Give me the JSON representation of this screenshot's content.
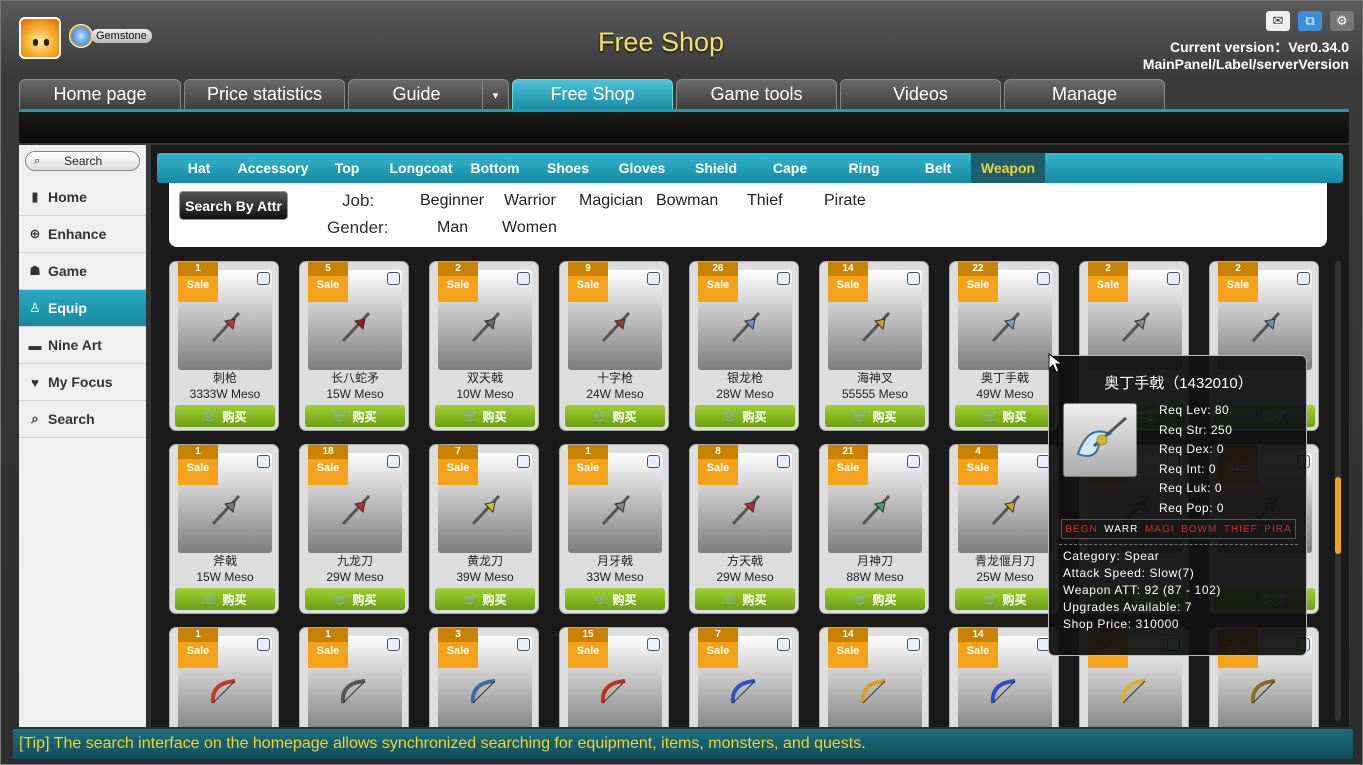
{
  "header": {
    "title": "Free Shop",
    "gem_label": "Gemstone",
    "version": "Current version：Ver0.34.0",
    "server_label": "MainPanel/Label/serverVersion"
  },
  "main_tabs": [
    {
      "label": "Home page"
    },
    {
      "label": "Price statistics"
    },
    {
      "label": "Guide"
    },
    {
      "label": "Free Shop"
    },
    {
      "label": "Game tools"
    },
    {
      "label": "Videos"
    },
    {
      "label": "Manage"
    }
  ],
  "sidebar": {
    "search_label": "Search",
    "items": [
      {
        "label": "Home",
        "icon": "bookmark-icon"
      },
      {
        "label": "Enhance",
        "icon": "plus-circle-icon"
      },
      {
        "label": "Game",
        "icon": "user-icon"
      },
      {
        "label": "Equip",
        "icon": "person-icon"
      },
      {
        "label": "Nine Art",
        "icon": "card-icon"
      },
      {
        "label": "My Focus",
        "icon": "heart-icon"
      },
      {
        "label": "Search",
        "icon": "search-icon"
      }
    ]
  },
  "category_tabs": [
    {
      "label": "Hat"
    },
    {
      "label": "Accessory"
    },
    {
      "label": "Top"
    },
    {
      "label": "Longcoat"
    },
    {
      "label": "Bottom"
    },
    {
      "label": "Shoes"
    },
    {
      "label": "Gloves"
    },
    {
      "label": "Shield"
    },
    {
      "label": "Cape"
    },
    {
      "label": "Ring"
    },
    {
      "label": "Belt"
    },
    {
      "label": "Weapon"
    }
  ],
  "filter": {
    "button": "Search By Attr",
    "job_label": "Job:",
    "gender_label": "Gender:",
    "jobs": [
      "Beginner",
      "Warrior",
      "Magician",
      "Bowman",
      "Thief",
      "Pirate"
    ],
    "genders": [
      "Man",
      "Women"
    ]
  },
  "sale_label": "Sale",
  "buy_label": "购买",
  "items": [
    {
      "count": "1",
      "name": "刺枪",
      "price": "3333W Meso"
    },
    {
      "count": "5",
      "name": "长八蛇矛",
      "price": "15W Meso"
    },
    {
      "count": "2",
      "name": "双天戟",
      "price": "10W Meso"
    },
    {
      "count": "9",
      "name": "十字枪",
      "price": "24W Meso"
    },
    {
      "count": "26",
      "name": "银龙枪",
      "price": "28W Meso"
    },
    {
      "count": "14",
      "name": "海神叉",
      "price": "55555 Meso"
    },
    {
      "count": "22",
      "name": "奥丁手戟",
      "price": "49W Meso"
    },
    {
      "count": "2",
      "name": "",
      "price": ""
    },
    {
      "count": "2",
      "name": "",
      "price": ""
    },
    {
      "count": "1",
      "name": "斧戟",
      "price": "15W Meso"
    },
    {
      "count": "18",
      "name": "九龙刀",
      "price": "29W Meso"
    },
    {
      "count": "7",
      "name": "黄龙刀",
      "price": "39W Meso"
    },
    {
      "count": "1",
      "name": "月牙戟",
      "price": "33W Meso"
    },
    {
      "count": "8",
      "name": "方天戟",
      "price": "29W Meso"
    },
    {
      "count": "21",
      "name": "月神刀",
      "price": "88W Meso"
    },
    {
      "count": "4",
      "name": "青龙偃月刀",
      "price": "25W Meso"
    },
    {
      "count": "",
      "name": "",
      "price": ""
    },
    {
      "count": "",
      "name": "",
      "price": ""
    },
    {
      "count": "1",
      "name": "",
      "price": ""
    },
    {
      "count": "1",
      "name": "",
      "price": ""
    },
    {
      "count": "3",
      "name": "",
      "price": ""
    },
    {
      "count": "15",
      "name": "",
      "price": ""
    },
    {
      "count": "7",
      "name": "",
      "price": ""
    },
    {
      "count": "14",
      "name": "",
      "price": ""
    },
    {
      "count": "14",
      "name": "",
      "price": ""
    },
    {
      "count": "",
      "name": "",
      "price": ""
    },
    {
      "count": "",
      "name": "",
      "price": ""
    }
  ],
  "tooltip": {
    "title": "奥丁手戟（1432010）",
    "reqs": [
      "Req Lev: 80",
      "Req Str: 250",
      "Req Dex: 0",
      "Req Int: 0",
      "Req Luk: 0",
      "Req Pop: 0"
    ],
    "jobs": [
      {
        "label": "BEGN",
        "color": "#d42b2b"
      },
      {
        "label": "WARR",
        "color": "#ffffff"
      },
      {
        "label": "MAGI",
        "color": "#d42b2b"
      },
      {
        "label": "BOWM",
        "color": "#d42b2b"
      },
      {
        "label": "THIEF",
        "color": "#d42b2b"
      },
      {
        "label": "PIRA",
        "color": "#d42b2b"
      }
    ],
    "lines": [
      "Category: Spear",
      "Attack Speed: Slow(7)",
      "Weapon ATT: 92 (87 - 102)",
      "Upgrades Available: 7",
      "Shop Price: 310000"
    ]
  },
  "tip": "[Tip] The search interface on the homepage allows synchronized searching for equipment, items, monsters, and quests.",
  "colors": {
    "accent": "#1e9bb1",
    "sale": "#f5a21b",
    "buy": "#7fb51f",
    "title": "#f1e36a"
  }
}
